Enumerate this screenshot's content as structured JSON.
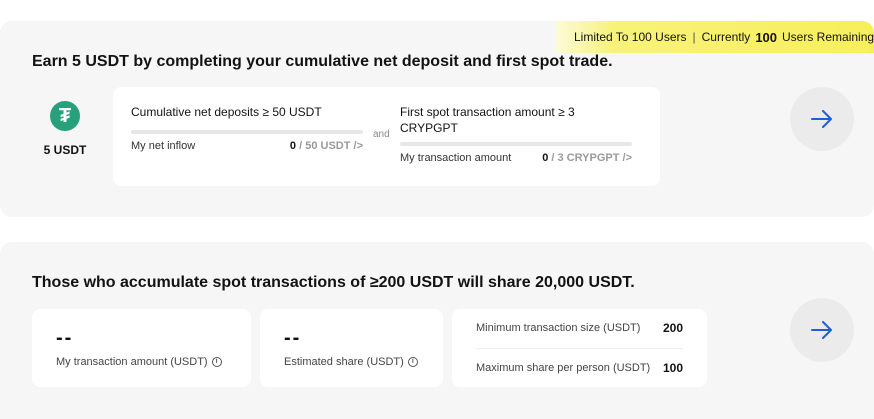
{
  "banner": {
    "prefix": "Limited To 100 Users",
    "currently": "Currently",
    "remaining_count": "100",
    "suffix": "Users Remaining"
  },
  "task_card": {
    "title": "Earn 5 USDT by completing your cumulative net deposit and first spot trade.",
    "reward_label": "5 USDT",
    "coin_symbol": "₮",
    "task1": {
      "title": "Cumulative net deposits ≥ 50 USDT",
      "progress_fraction": 0,
      "label": "My net inflow",
      "current": "0",
      "target": " / 50 USDT />"
    },
    "and_label": "and",
    "task2": {
      "title": "First spot transaction amount ≥ 3 CRYPGPT",
      "progress_fraction": 0,
      "label": "My transaction amount",
      "current": "0",
      "target": " / 3 CRYPGPT />"
    }
  },
  "pool_card": {
    "title": "Those who accumulate spot transactions of ≥200 USDT will share 20,000 USDT.",
    "stat1": {
      "value": "--",
      "label": "My transaction amount (USDT)"
    },
    "stat2": {
      "value": "--",
      "label": "Estimated share (USDT)"
    },
    "limits": [
      {
        "label": "Minimum transaction size (USDT)",
        "value": "200"
      },
      {
        "label": "Maximum share per person (USDT)",
        "value": "100"
      }
    ]
  },
  "colors": {
    "accent": "#1e5fd6",
    "tether": "#26a17b",
    "banner": "#f7ef5a"
  },
  "icons": {
    "go": "arrow-right-icon",
    "info": "info-icon",
    "coin": "tether-icon"
  }
}
